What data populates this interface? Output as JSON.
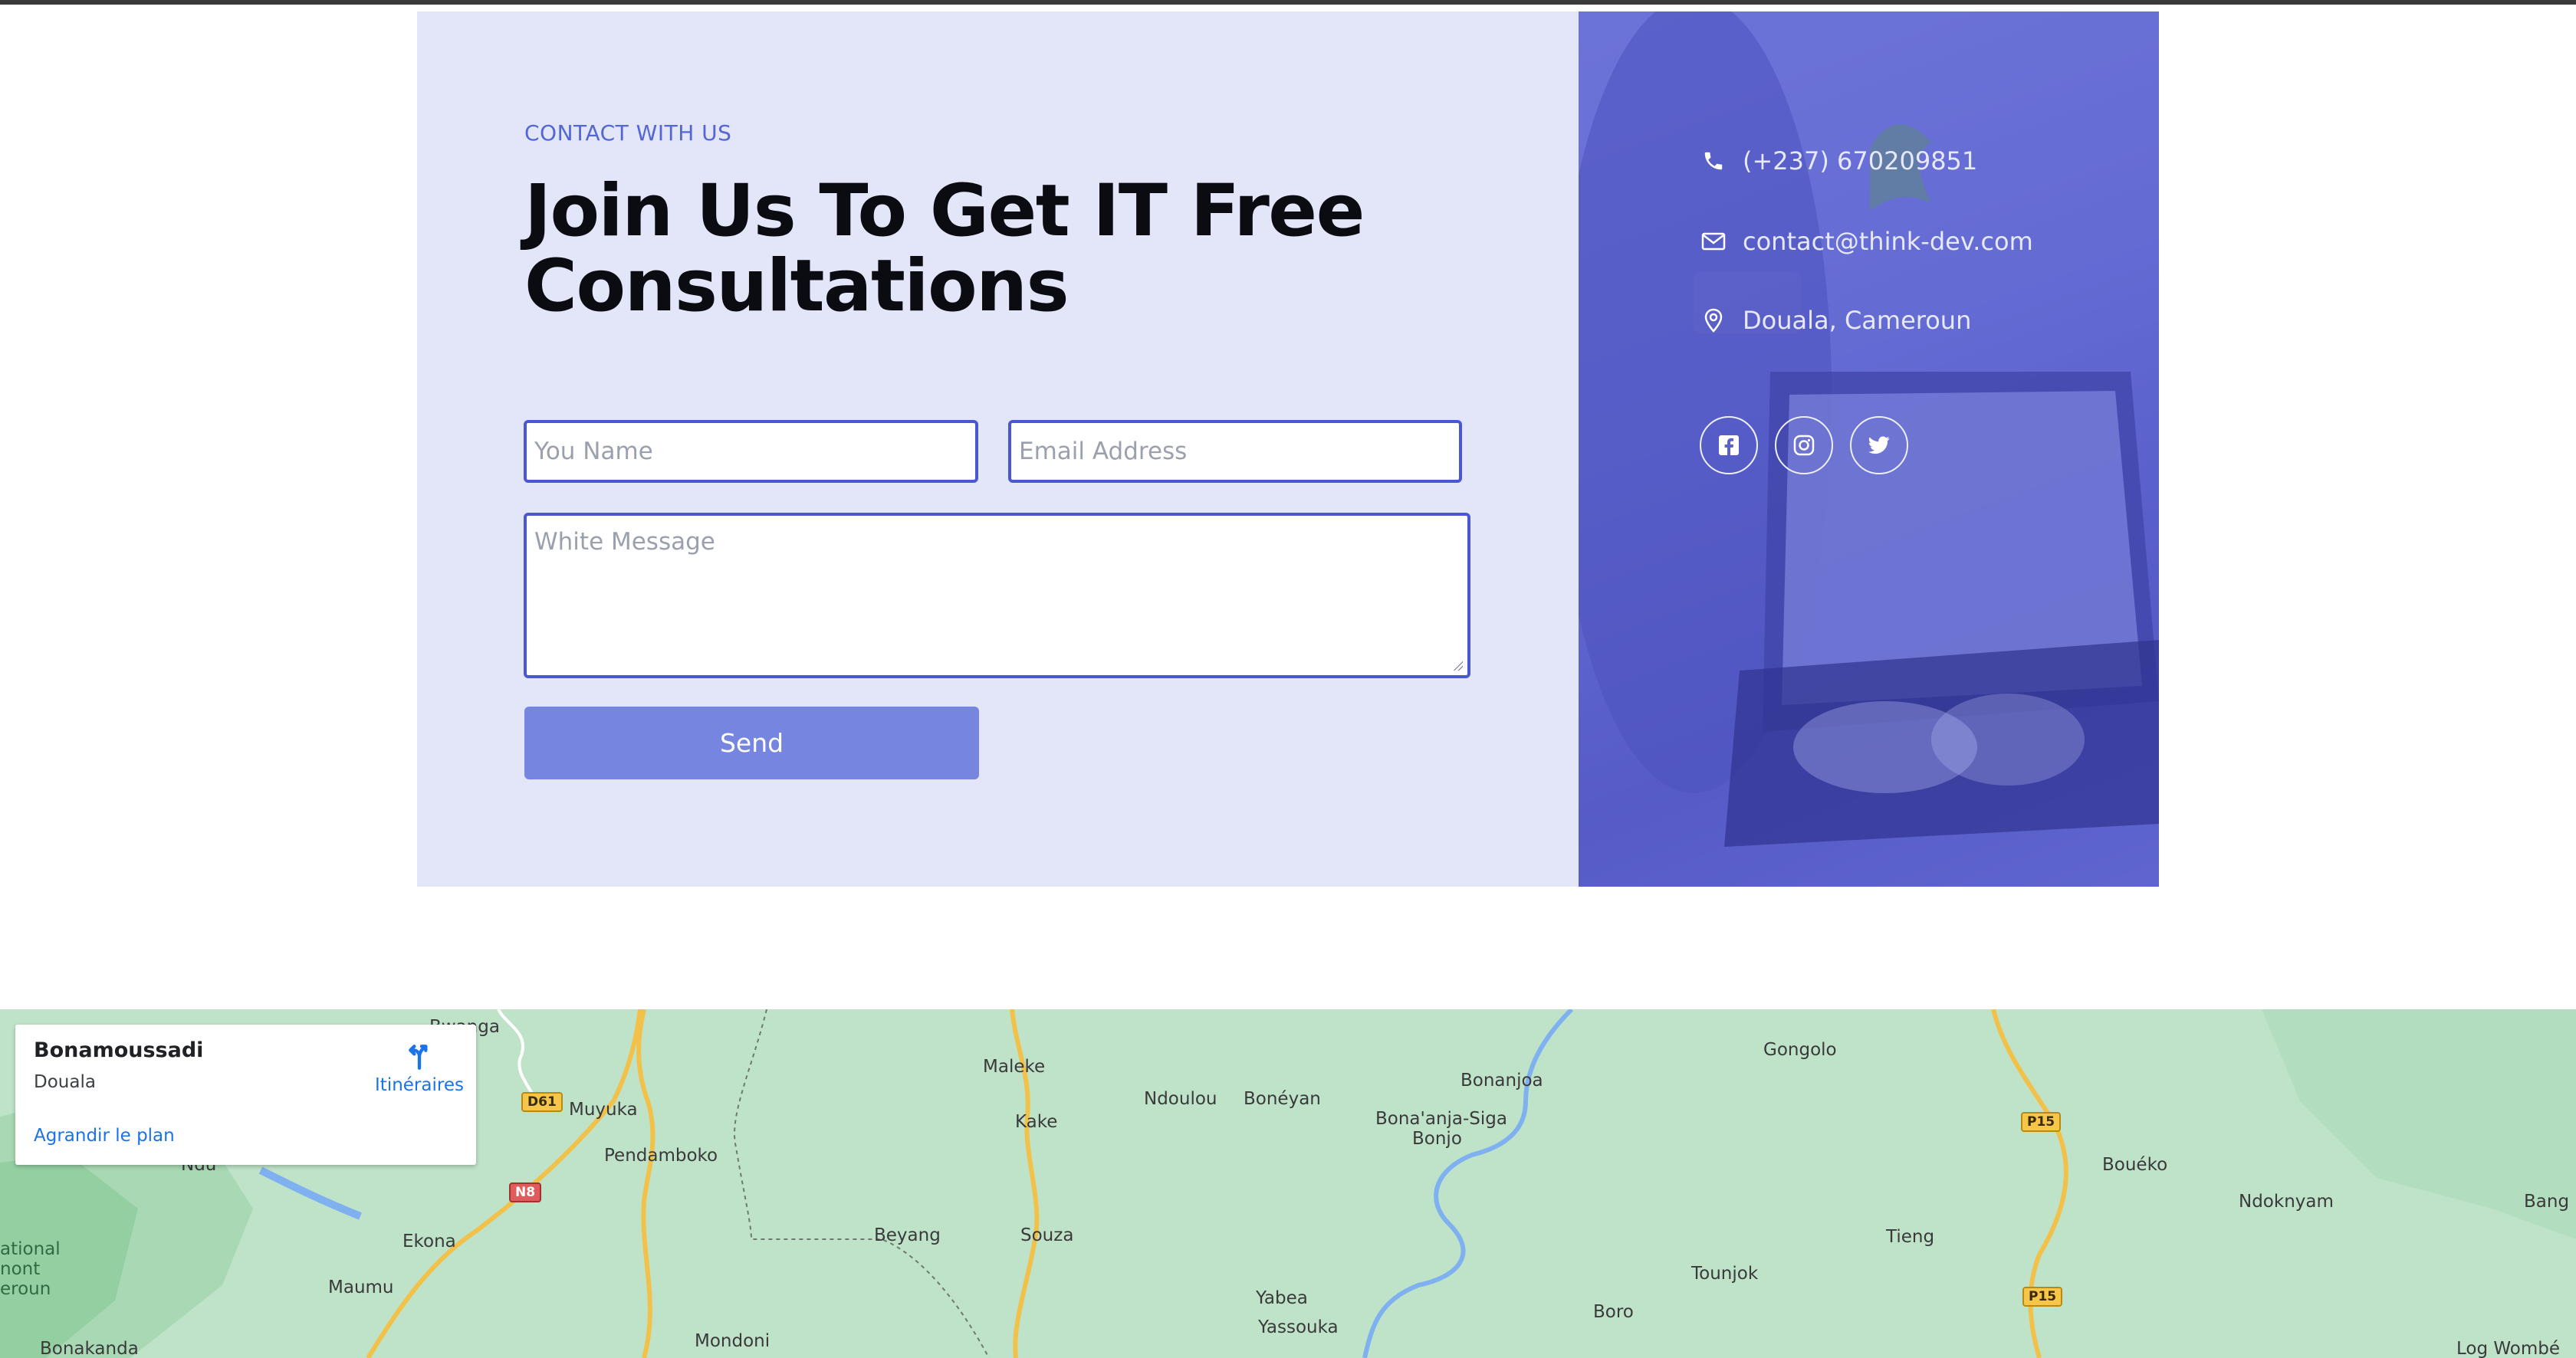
{
  "contact": {
    "eyebrow": "CONTACT WITH US",
    "headline": "Join Us To Get IT Free Consultations",
    "form": {
      "name_placeholder": "You Name",
      "email_placeholder": "Email Address",
      "message_placeholder": "White Message",
      "send_label": "Send"
    },
    "info": {
      "phone": "(+237) 670209851",
      "email": "contact@think-dev.com",
      "address": "Douala, Cameroun"
    },
    "social": [
      {
        "icon": "facebook-icon"
      },
      {
        "icon": "instagram-icon"
      },
      {
        "icon": "twitter-icon"
      }
    ],
    "colors": {
      "panel_bg": "#e3e6f8",
      "accent": "#4a57d3",
      "button": "#7685e0",
      "overlay": "#5a60cc"
    }
  },
  "map": {
    "card": {
      "title": "Bonamoussadi",
      "subtitle": "Douala",
      "enlarge_link": "Agrandir le plan",
      "directions_label": "Itinéraires"
    },
    "places": [
      "Bwanga",
      "Muyuka",
      "Pendamboko",
      "Ekona",
      "Maumu",
      "Bonakanda",
      "Maleke",
      "Kake",
      "Ndoulou",
      "Bonéyan",
      "Bonanjoa",
      "Bona'anja-Siga",
      "Bonjo",
      "Beyang",
      "Souza",
      "Mondoni",
      "Yabea",
      "Yassouka",
      "Boro",
      "Tounjok",
      "Tieng",
      "Gongolo",
      "Bouéko",
      "Ndoknyam",
      "Bang",
      "Log Wombé",
      "Ndu",
      "ational",
      "nont",
      "eroun"
    ],
    "road_labels": [
      "D61",
      "N8",
      "P15",
      "P15"
    ]
  }
}
